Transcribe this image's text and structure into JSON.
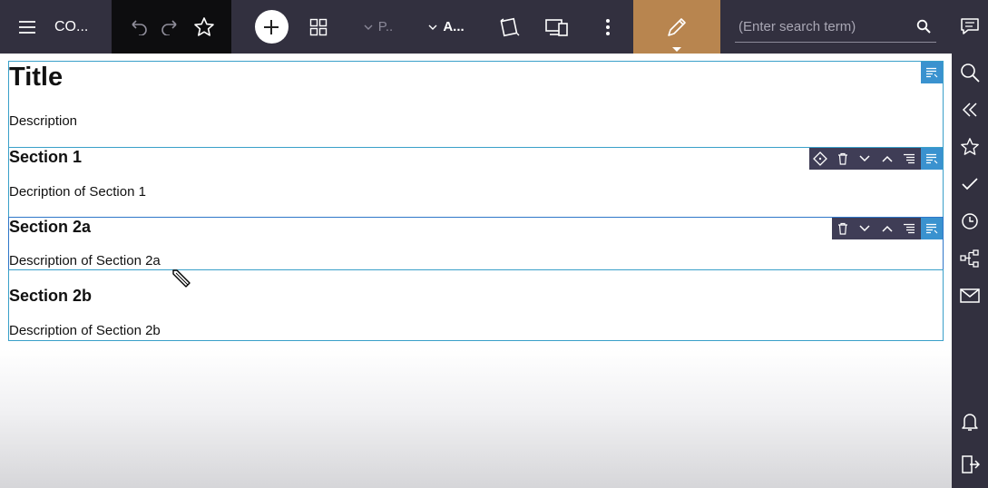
{
  "app": {
    "name": "CO..."
  },
  "toolbar": {
    "dropdown_p": "P..",
    "dropdown_a": "A...",
    "colors": {
      "bar": "#32303f",
      "history_group": "#0d0d0f",
      "edit_active": "#b8854f"
    }
  },
  "search": {
    "placeholder": "(Enter search term)",
    "value": ""
  },
  "document": {
    "title": "Title",
    "description": "Description",
    "sections": [
      {
        "heading": "Section 1",
        "description": "Decription of Section 1"
      },
      {
        "heading": "Section 2a",
        "description": "Description of Section 2a"
      },
      {
        "heading": "Section 2b",
        "description": "Description of Section 2b"
      }
    ]
  },
  "icons": {
    "toolbar": [
      "menu-icon",
      "undo-icon",
      "redo-icon",
      "star-icon",
      "plus-icon",
      "grid-icon",
      "chevron-down-icon",
      "rotate-icon",
      "devices-icon",
      "more-vertical-icon",
      "pencil-icon",
      "search-icon"
    ],
    "sidebar": [
      "chat-icon",
      "search-icon",
      "collapse-icon",
      "star-icon",
      "check-icon",
      "clock-icon",
      "hierarchy-icon",
      "mail-icon",
      "bell-icon",
      "logout-icon"
    ],
    "block_controls": [
      "move-icon",
      "delete-icon",
      "move-down-icon",
      "move-up-icon",
      "align-icon",
      "text-format-icon"
    ]
  }
}
